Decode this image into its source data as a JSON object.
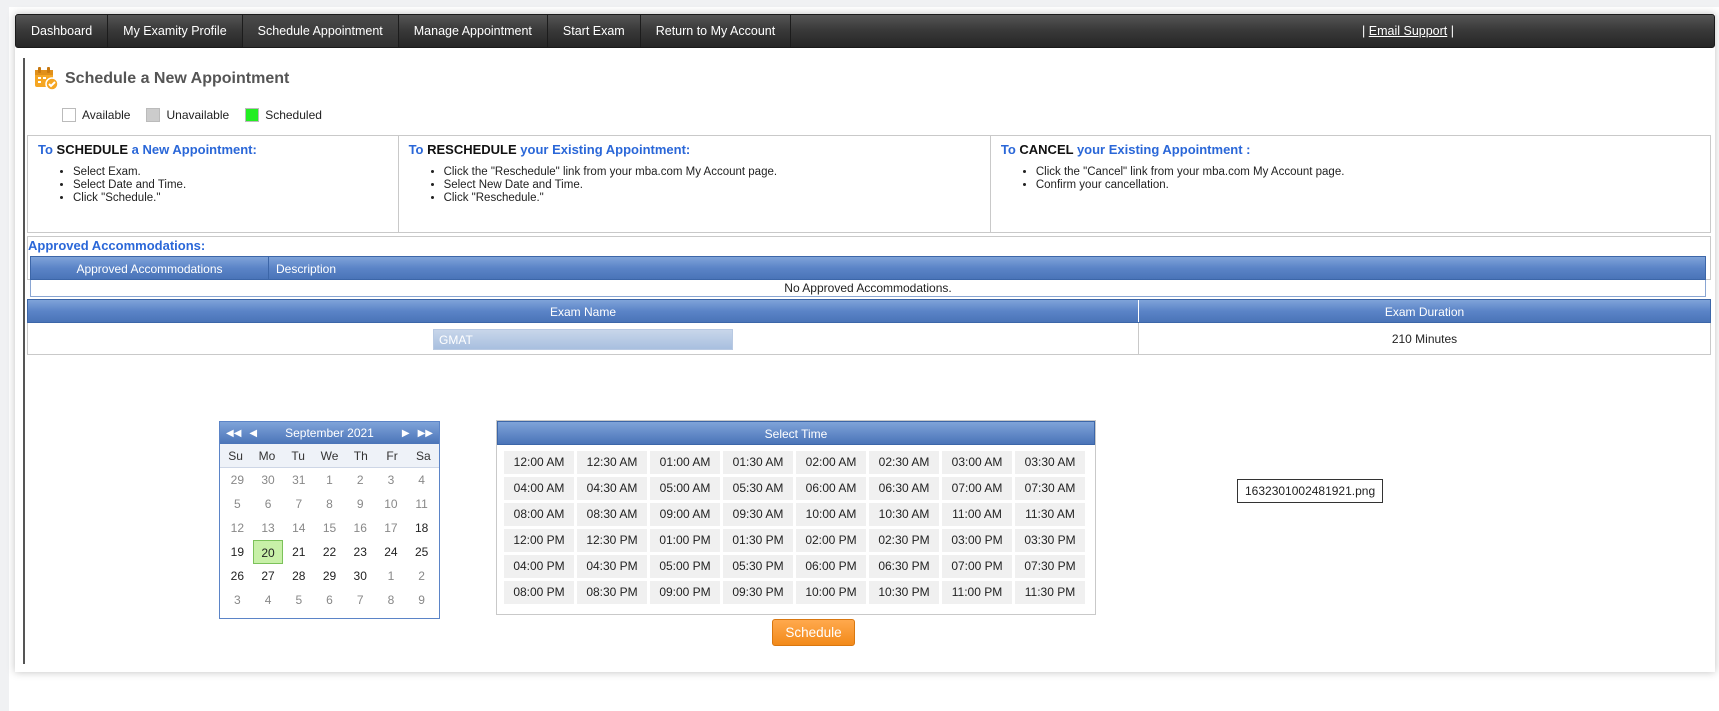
{
  "nav": {
    "items": [
      "Dashboard",
      "My Examity Profile",
      "Schedule Appointment",
      "Manage Appointment",
      "Start Exam",
      "Return to My Account"
    ],
    "active_index": 2,
    "support_prefix": "| ",
    "support_link": "Email Support",
    "support_suffix": " |"
  },
  "page": {
    "title": "Schedule a New Appointment",
    "legend": [
      {
        "label": "Available",
        "color": "#ffffff"
      },
      {
        "label": "Unavailable",
        "color": "#cccccc"
      },
      {
        "label": "Scheduled",
        "color": "#22ee22"
      }
    ]
  },
  "instructions": [
    {
      "pre": "To ",
      "key": "SCHEDULE",
      "post": " a New Appointment:",
      "steps": [
        "Select Exam.",
        "Select Date and Time.",
        "Click \"Schedule.\""
      ]
    },
    {
      "pre": "To ",
      "key": "RESCHEDULE",
      "post": " your Existing Appointment:",
      "steps": [
        "Click the \"Reschedule\" link from your mba.com My Account page.",
        "Select New Date and Time.",
        "Click \"Reschedule.\""
      ]
    },
    {
      "pre": "To ",
      "key": "CANCEL",
      "post": " your Existing Appointment :",
      "steps": [
        "Click the \"Cancel\" link from your mba.com My Account page.",
        "Confirm your cancellation."
      ]
    }
  ],
  "accommodations": {
    "title": "Approved Accommodations:",
    "col1": "Approved Accommodations",
    "col2": "Description",
    "empty": "No Approved Accommodations."
  },
  "exam": {
    "col_name": "Exam Name",
    "col_duration": "Exam Duration",
    "selected": "GMAT",
    "duration": "210 Minutes"
  },
  "calendar": {
    "month": "September 2021",
    "dow": [
      "Su",
      "Mo",
      "Tu",
      "We",
      "Th",
      "Fr",
      "Sa"
    ],
    "days": [
      {
        "d": "29",
        "dim": true
      },
      {
        "d": "30",
        "dim": true
      },
      {
        "d": "31",
        "dim": true
      },
      {
        "d": "1",
        "dim": true
      },
      {
        "d": "2",
        "dim": true
      },
      {
        "d": "3",
        "dim": true
      },
      {
        "d": "4",
        "dim": true
      },
      {
        "d": "5",
        "dim": true
      },
      {
        "d": "6",
        "dim": true
      },
      {
        "d": "7",
        "dim": true
      },
      {
        "d": "8",
        "dim": true
      },
      {
        "d": "9",
        "dim": true
      },
      {
        "d": "10",
        "dim": true
      },
      {
        "d": "11",
        "dim": true
      },
      {
        "d": "12",
        "dim": true
      },
      {
        "d": "13",
        "dim": true
      },
      {
        "d": "14",
        "dim": true
      },
      {
        "d": "15",
        "dim": true
      },
      {
        "d": "16",
        "dim": true
      },
      {
        "d": "17",
        "dim": true
      },
      {
        "d": "18",
        "dim": false
      },
      {
        "d": "19",
        "dim": false
      },
      {
        "d": "20",
        "dim": false,
        "today": true
      },
      {
        "d": "21",
        "dim": false
      },
      {
        "d": "22",
        "dim": false
      },
      {
        "d": "23",
        "dim": false
      },
      {
        "d": "24",
        "dim": false
      },
      {
        "d": "25",
        "dim": false
      },
      {
        "d": "26",
        "dim": false
      },
      {
        "d": "27",
        "dim": false
      },
      {
        "d": "28",
        "dim": false
      },
      {
        "d": "29",
        "dim": false
      },
      {
        "d": "30",
        "dim": false
      },
      {
        "d": "1",
        "dim": true
      },
      {
        "d": "2",
        "dim": true
      },
      {
        "d": "3",
        "dim": true
      },
      {
        "d": "4",
        "dim": true
      },
      {
        "d": "5",
        "dim": true
      },
      {
        "d": "6",
        "dim": true
      },
      {
        "d": "7",
        "dim": true
      },
      {
        "d": "8",
        "dim": true
      },
      {
        "d": "9",
        "dim": true
      }
    ]
  },
  "time": {
    "title": "Select Time",
    "slots": [
      "12:00 AM",
      "12:30 AM",
      "01:00 AM",
      "01:30 AM",
      "02:00 AM",
      "02:30 AM",
      "03:00 AM",
      "03:30 AM",
      "04:00 AM",
      "04:30 AM",
      "05:00 AM",
      "05:30 AM",
      "06:00 AM",
      "06:30 AM",
      "07:00 AM",
      "07:30 AM",
      "08:00 AM",
      "08:30 AM",
      "09:00 AM",
      "09:30 AM",
      "10:00 AM",
      "10:30 AM",
      "11:00 AM",
      "11:30 AM",
      "12:00 PM",
      "12:30 PM",
      "01:00 PM",
      "01:30 PM",
      "02:00 PM",
      "02:30 PM",
      "03:00 PM",
      "03:30 PM",
      "04:00 PM",
      "04:30 PM",
      "05:00 PM",
      "05:30 PM",
      "06:00 PM",
      "06:30 PM",
      "07:00 PM",
      "07:30 PM",
      "08:00 PM",
      "08:30 PM",
      "09:00 PM",
      "09:30 PM",
      "10:00 PM",
      "10:30 PM",
      "11:00 PM",
      "11:30 PM"
    ]
  },
  "schedule_button": "Schedule",
  "filename_label": "1632301002481921.png"
}
